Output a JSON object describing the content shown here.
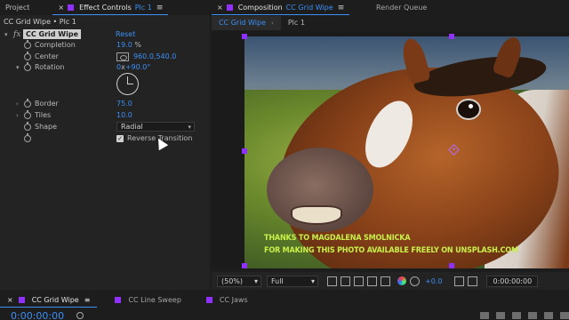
{
  "left_panel": {
    "tabs": [
      {
        "label": "Project"
      },
      {
        "label": "Effect Controls",
        "target": "Plc 1"
      }
    ],
    "title": "CC Grid Wipe • Plc 1",
    "effect": {
      "name": "CC Grid Wipe",
      "reset": "Reset",
      "properties": {
        "completion": {
          "label": "Completion",
          "value": "19.0",
          "unit": "%"
        },
        "center": {
          "label": "Center",
          "value": "960.0,540.0"
        },
        "rotation": {
          "label": "Rotation",
          "value": "0",
          "x": "x",
          "deg": "+90.0",
          "deg_unit": "°"
        },
        "border": {
          "label": "Border",
          "value": "75.0"
        },
        "tiles": {
          "label": "Tiles",
          "value": "10.0"
        },
        "shape": {
          "label": "Shape",
          "value": "Radial"
        },
        "reverse": {
          "label": "Reverse Transition",
          "checked": true
        }
      }
    }
  },
  "comp_panel": {
    "tab": {
      "label": "Composition",
      "comp": "CC Grid Wipe"
    },
    "render_queue": "Render Queue",
    "subtabs": [
      "CC Grid Wipe",
      "Plc 1"
    ],
    "credit_line1": "THANKS TO MAGDALENA SMOLNICKA",
    "credit_line2": "FOR MAKING THIS PHOTO AVAILABLE FREELY ON UNSPLASH.COM",
    "toolbar": {
      "zoom": "(50%)",
      "resolution": "Full",
      "exposure": "+0.0",
      "timecode": "0:00:00:00"
    }
  },
  "timeline": {
    "tabs": [
      "CC Grid Wipe",
      "CC Line Sweep",
      "CC Jaws"
    ],
    "timecode": "0:00:00:00"
  },
  "colors": {
    "accent_blue": "#3b8ff5",
    "label_purple": "#8f30ff",
    "credit_green": "#c8f04a"
  }
}
